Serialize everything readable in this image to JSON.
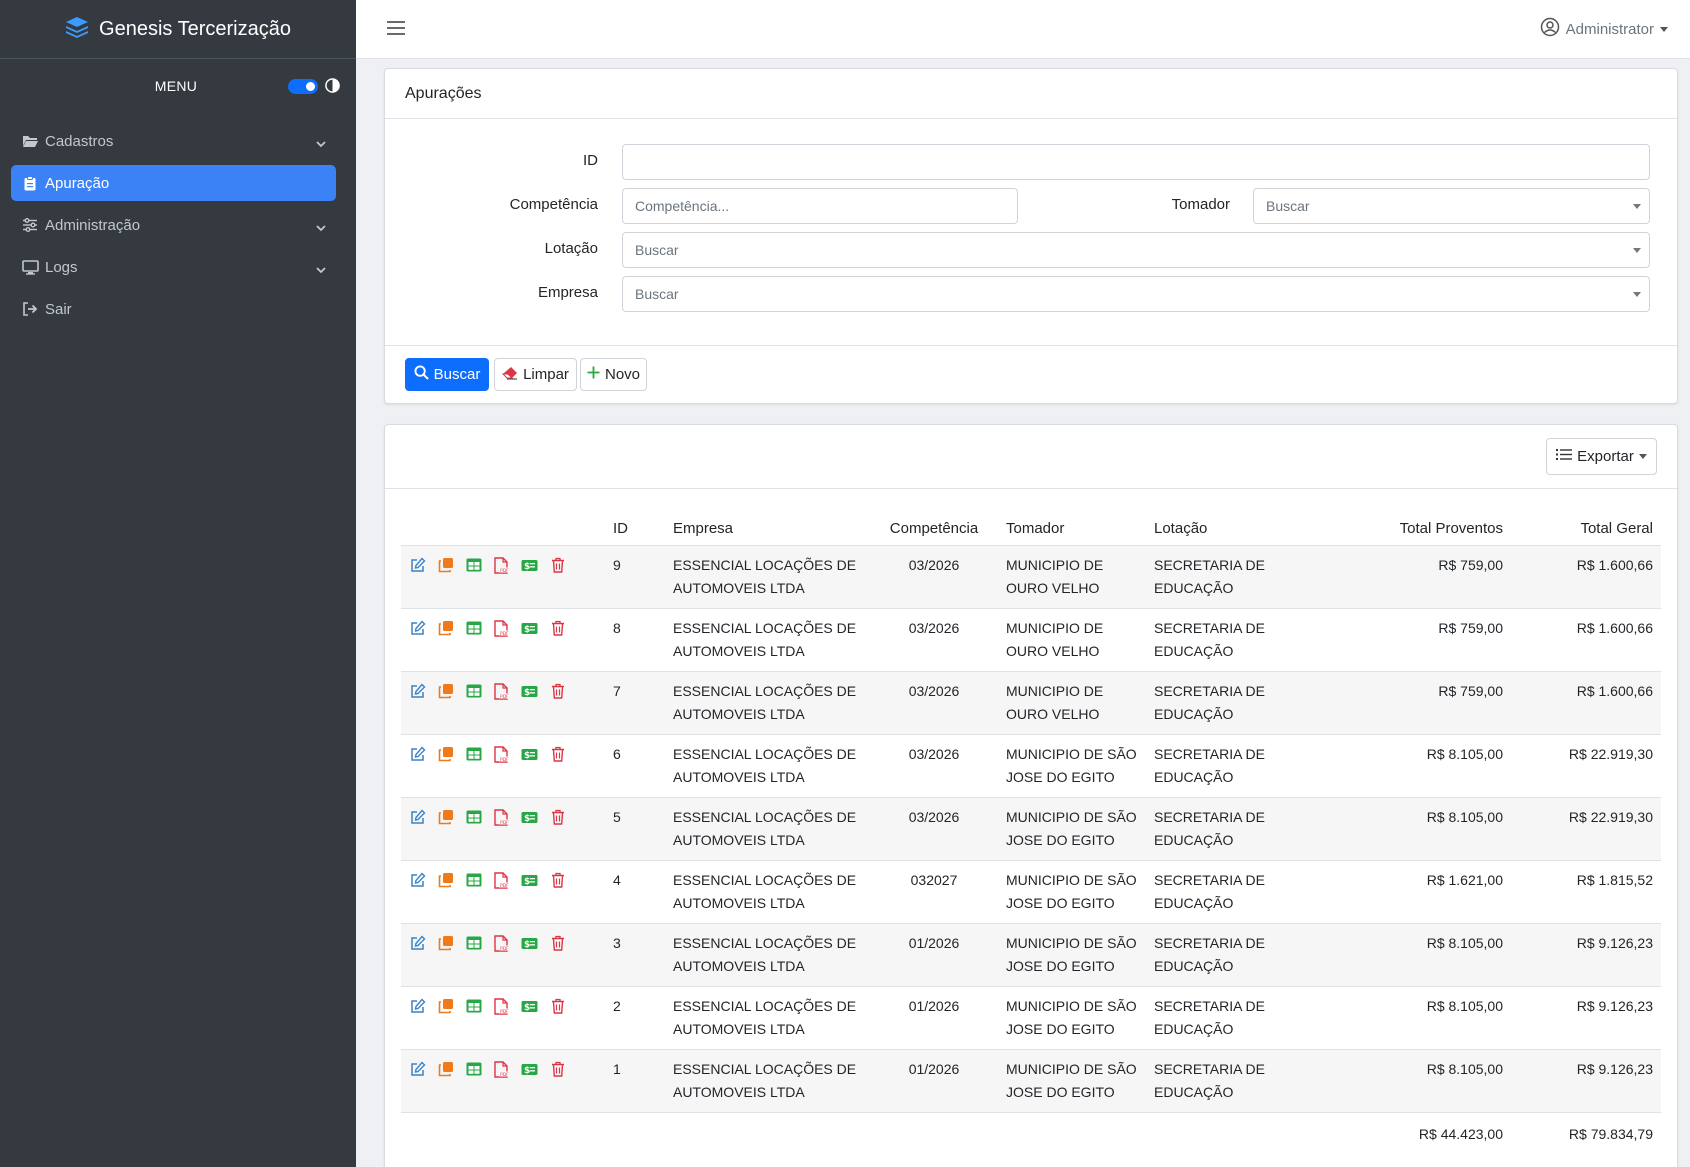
{
  "brand": {
    "title": "Genesis Tercerização"
  },
  "sidebar": {
    "menu_label": "MENU",
    "items": [
      {
        "label": "Cadastros",
        "icon": "folder-open-icon",
        "has_children": true
      },
      {
        "label": "Apuração",
        "icon": "clipboard-icon",
        "active": true
      },
      {
        "label": "Administração",
        "icon": "sliders-icon",
        "has_children": true
      },
      {
        "label": "Logs",
        "icon": "monitor-icon",
        "has_children": true
      },
      {
        "label": "Sair",
        "icon": "sign-out-icon"
      }
    ]
  },
  "topbar": {
    "user": "Administrator"
  },
  "filters": {
    "title": "Apurações",
    "id_label": "ID",
    "id_value": "",
    "competencia_label": "Competência",
    "competencia_placeholder": "Competência...",
    "tomador_label": "Tomador",
    "tomador_placeholder": "Buscar",
    "lotacao_label": "Lotação",
    "lotacao_placeholder": "Buscar",
    "empresa_label": "Empresa",
    "empresa_placeholder": "Buscar",
    "buscar_label": "Buscar",
    "limpar_label": "Limpar",
    "novo_label": "Novo"
  },
  "table": {
    "export_label": "Exportar",
    "headers": [
      "ID",
      "Empresa",
      "Competência",
      "Tomador",
      "Lotação",
      "Total Proventos",
      "Total Geral"
    ],
    "rows": [
      {
        "id": "9",
        "empresa": "ESSENCIAL LOCAÇÕES DE AUTOMOVEIS LTDA",
        "competencia": "03/2026",
        "tomador": "MUNICIPIO DE OURO VELHO",
        "lotacao": "SECRETARIA DE EDUCAÇÃO",
        "proventos": "R$ 759,00",
        "geral": "R$ 1.600,66"
      },
      {
        "id": "8",
        "empresa": "ESSENCIAL LOCAÇÕES DE AUTOMOVEIS LTDA",
        "competencia": "03/2026",
        "tomador": "MUNICIPIO DE OURO VELHO",
        "lotacao": "SECRETARIA DE EDUCAÇÃO",
        "proventos": "R$ 759,00",
        "geral": "R$ 1.600,66"
      },
      {
        "id": "7",
        "empresa": "ESSENCIAL LOCAÇÕES DE AUTOMOVEIS LTDA",
        "competencia": "03/2026",
        "tomador": "MUNICIPIO DE OURO VELHO",
        "lotacao": "SECRETARIA DE EDUCAÇÃO",
        "proventos": "R$ 759,00",
        "geral": "R$ 1.600,66"
      },
      {
        "id": "6",
        "empresa": "ESSENCIAL LOCAÇÕES DE AUTOMOVEIS LTDA",
        "competencia": "03/2026",
        "tomador": "MUNICIPIO DE SÃO JOSE DO EGITO",
        "lotacao": "SECRETARIA DE EDUCAÇÃO",
        "proventos": "R$ 8.105,00",
        "geral": "R$ 22.919,30"
      },
      {
        "id": "5",
        "empresa": "ESSENCIAL LOCAÇÕES DE AUTOMOVEIS LTDA",
        "competencia": "03/2026",
        "tomador": "MUNICIPIO DE SÃO JOSE DO EGITO",
        "lotacao": "SECRETARIA DE EDUCAÇÃO",
        "proventos": "R$ 8.105,00",
        "geral": "R$ 22.919,30"
      },
      {
        "id": "4",
        "empresa": "ESSENCIAL LOCAÇÕES DE AUTOMOVEIS LTDA",
        "competencia": "032027",
        "tomador": "MUNICIPIO DE SÃO JOSE DO EGITO",
        "lotacao": "SECRETARIA DE EDUCAÇÃO",
        "proventos": "R$ 1.621,00",
        "geral": "R$ 1.815,52"
      },
      {
        "id": "3",
        "empresa": "ESSENCIAL LOCAÇÕES DE AUTOMOVEIS LTDA",
        "competencia": "01/2026",
        "tomador": "MUNICIPIO DE SÃO JOSE DO EGITO",
        "lotacao": "SECRETARIA DE EDUCAÇÃO",
        "proventos": "R$ 8.105,00",
        "geral": "R$ 9.126,23"
      },
      {
        "id": "2",
        "empresa": "ESSENCIAL LOCAÇÕES DE AUTOMOVEIS LTDA",
        "competencia": "01/2026",
        "tomador": "MUNICIPIO DE SÃO JOSE DO EGITO",
        "lotacao": "SECRETARIA DE EDUCAÇÃO",
        "proventos": "R$ 8.105,00",
        "geral": "R$ 9.126,23"
      },
      {
        "id": "1",
        "empresa": "ESSENCIAL LOCAÇÕES DE AUTOMOVEIS LTDA",
        "competencia": "01/2026",
        "tomador": "MUNICIPIO DE SÃO JOSE DO EGITO",
        "lotacao": "SECRETARIA DE EDUCAÇÃO",
        "proventos": "R$ 8.105,00",
        "geral": "R$ 9.126,23"
      }
    ],
    "total_proventos": "R$ 44.423,00",
    "total_geral": "R$ 79.834,79"
  },
  "colors": {
    "primary": "#0d6efd",
    "sidebar": "#343a40",
    "edit": "#3b82c4",
    "copy": "#f07a1a",
    "sheet": "#28a745",
    "pdf": "#dc3545",
    "money": "#28a745",
    "delete": "#dc3545"
  }
}
